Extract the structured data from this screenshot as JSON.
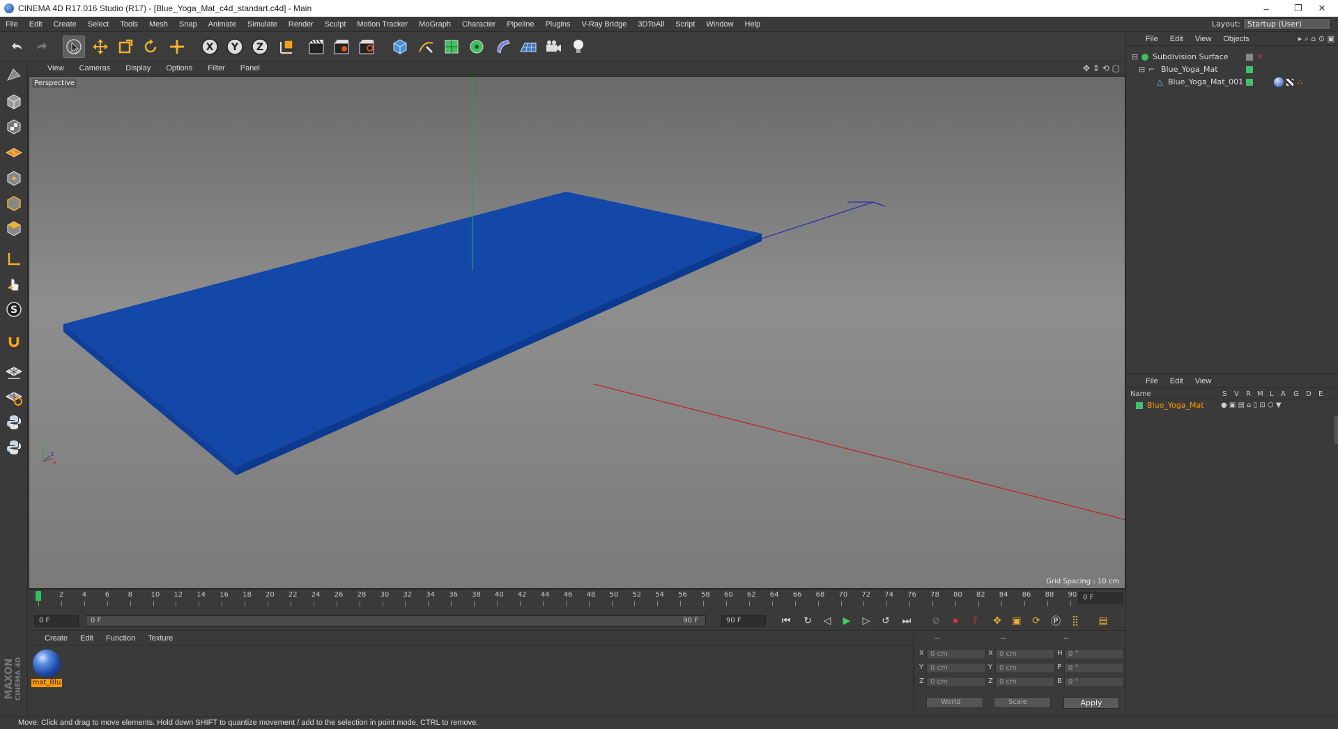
{
  "window": {
    "title": "CINEMA 4D R17.016 Studio (R17) - [Blue_Yoga_Mat_c4d_standart.c4d] - Main",
    "controls": [
      "–",
      "❐",
      "✕"
    ]
  },
  "menubar": {
    "items": [
      "File",
      "Edit",
      "Create",
      "Select",
      "Tools",
      "Mesh",
      "Snap",
      "Animate",
      "Simulate",
      "Render",
      "Sculpt",
      "Motion Tracker",
      "MoGraph",
      "Character",
      "Pipeline",
      "Plugins",
      "V-Ray Bridge",
      "3DToAll",
      "Script",
      "Window",
      "Help"
    ],
    "layout_label": "Layout:",
    "layout_value": "Startup (User)"
  },
  "toolbar": {
    "icons": [
      "undo-icon",
      "redo-icon",
      "live-select-icon",
      "move-icon",
      "scale-icon",
      "rotate-icon",
      "transform-icon",
      "x-axis-icon",
      "y-axis-icon",
      "z-axis-icon",
      "coordinate-system-icon",
      "render-view-icon",
      "render-picture-viewer-icon",
      "render-settings-icon",
      "cube-icon",
      "spline-pen-icon",
      "subdivision-icon",
      "cloner-icon",
      "deformer-icon",
      "floor-icon",
      "camera-icon",
      "light-icon"
    ],
    "axis_labels": [
      "X",
      "Y",
      "Z"
    ]
  },
  "left_tools": {
    "icons": [
      "make-editable-icon",
      "model-mode-icon",
      "texture-mode-icon",
      "workplane-icon",
      "points-mode-icon",
      "edges-mode-icon",
      "polygons-mode-icon",
      "axis-mode-icon",
      "tweak-icon",
      "snap-icon",
      "magnet-icon",
      "workplane-grid-icon",
      "locked-workplane-icon",
      "python-icon",
      "python-2-icon"
    ],
    "snap_letter": "S"
  },
  "viewport": {
    "menu": [
      "View",
      "Cameras",
      "Display",
      "Options",
      "Filter",
      "Panel"
    ],
    "label": "Perspective",
    "grid_spacing": "Grid Spacing : 10 cm",
    "mat_color": "#1448a8",
    "axis_y_label": "y",
    "axis_z_label": "z",
    "axis_x_label": "x"
  },
  "timeline": {
    "ticks": [
      "0",
      "2",
      "4",
      "6",
      "8",
      "10",
      "12",
      "14",
      "16",
      "18",
      "20",
      "22",
      "24",
      "26",
      "28",
      "30",
      "32",
      "34",
      "36",
      "38",
      "40",
      "42",
      "44",
      "46",
      "48",
      "50",
      "52",
      "54",
      "56",
      "58",
      "60",
      "62",
      "64",
      "66",
      "68",
      "70",
      "72",
      "74",
      "76",
      "78",
      "80",
      "82",
      "84",
      "86",
      "88",
      "90"
    ],
    "current_frame": "0 F"
  },
  "playbar": {
    "start_field": "0 F",
    "range_start": "0 F",
    "range_end": "90 F",
    "end_field": "90 F"
  },
  "materials": {
    "menu": [
      "Create",
      "Edit",
      "Function",
      "Texture"
    ],
    "items": [
      {
        "name": "mat_Blu"
      }
    ]
  },
  "brand": {
    "maxon": "MAXON",
    "cinema": "CINEMA 4D"
  },
  "coordinates": {
    "headers": [
      "--",
      "--",
      "--"
    ],
    "rows": [
      {
        "axis": "X",
        "pos": "0 cm",
        "size_axis": "X",
        "size": "0 cm",
        "rot_axis": "H",
        "rot": "0 °"
      },
      {
        "axis": "Y",
        "pos": "0 cm",
        "size_axis": "Y",
        "size": "0 cm",
        "rot_axis": "P",
        "rot": "0 °"
      },
      {
        "axis": "Z",
        "pos": "0 cm",
        "size_axis": "Z",
        "size": "0 cm",
        "rot_axis": "B",
        "rot": "0 °"
      }
    ],
    "mode": "World",
    "size_mode": "Scale",
    "apply": "Apply"
  },
  "objects_panel": {
    "menu": [
      "File",
      "Edit",
      "View",
      "Objects"
    ],
    "tree": [
      {
        "name": "Subdivision Surface",
        "color": "#dddddd"
      },
      {
        "name": "Blue_Yoga_Mat",
        "color": "#dddddd"
      },
      {
        "name": "Blue_Yoga_Mat_001",
        "color": "#dddddd"
      }
    ]
  },
  "attributes_panel": {
    "menu": [
      "File",
      "Edit",
      "View"
    ],
    "columns": [
      "Name",
      "S",
      "V",
      "R",
      "M",
      "L",
      "A",
      "G",
      "D",
      "E"
    ],
    "row_name": "Blue_Yoga_Mat",
    "row_color": "#ff9a00"
  },
  "status": {
    "text": "Move: Click and drag to move elements. Hold down SHIFT to quantize movement / add to the selection in point mode, CTRL to remove."
  }
}
